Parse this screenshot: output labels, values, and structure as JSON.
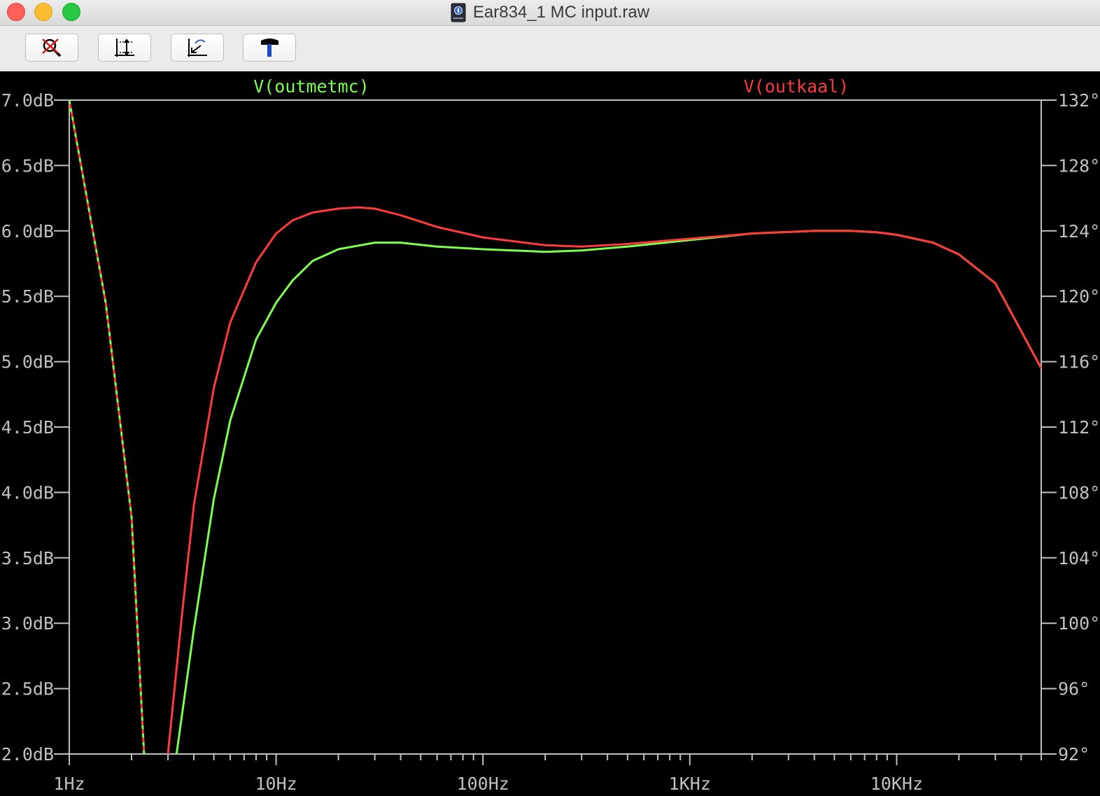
{
  "window": {
    "title": "Ear834_1 MC input.raw"
  },
  "toolbar": {
    "buttons": [
      {
        "name": "zoom-cancel",
        "icon": "zoom-cancel-icon"
      },
      {
        "name": "autorange-y",
        "icon": "autorange-y-icon"
      },
      {
        "name": "back-trace",
        "icon": "back-trace-icon"
      },
      {
        "name": "tools",
        "icon": "hammer-icon"
      }
    ]
  },
  "colors": {
    "background": "#000000",
    "axis": "#c0c0c0",
    "series_outmetmc": "#7cff4f",
    "series_outkaal": "#ff3a3a"
  },
  "chart_data": {
    "type": "line",
    "x_scale": "log",
    "x_ticks": [
      "1Hz",
      "10Hz",
      "100Hz",
      "1KHz",
      "10KHz"
    ],
    "xlim": [
      1,
      50000
    ],
    "y_left_ticks": [
      "7.0dB",
      "6.5dB",
      "6.0dB",
      "5.5dB",
      "5.0dB",
      "4.5dB",
      "4.0dB",
      "3.5dB",
      "3.0dB",
      "2.5dB",
      "2.0dB"
    ],
    "y_right_ticks": [
      "132°",
      "128°",
      "124°",
      "120°",
      "116°",
      "112°",
      "108°",
      "104°",
      "100°",
      "96°",
      "92°"
    ],
    "ylim_left": [
      2.0,
      7.0
    ],
    "ylim_right": [
      92,
      132
    ],
    "grid": false,
    "series": [
      {
        "name": "V(outmetmc)",
        "color": "#7cff4f",
        "magnitude": {
          "x": [
            3.3,
            4,
            5,
            6,
            8,
            10,
            12,
            15,
            20,
            30,
            40,
            60,
            100,
            200,
            300,
            500,
            1000,
            2000,
            4000,
            6000,
            8000,
            10000,
            15000,
            20000,
            30000,
            50000
          ],
          "y": [
            2.0,
            2.95,
            3.95,
            4.55,
            5.17,
            5.45,
            5.62,
            5.77,
            5.86,
            5.91,
            5.91,
            5.88,
            5.86,
            5.84,
            5.85,
            5.88,
            5.93,
            5.98,
            6.0,
            6.0,
            5.99,
            5.97,
            5.91,
            5.82,
            5.6,
            4.95
          ]
        },
        "phase": {
          "x": [
            1,
            1.5,
            2,
            2.3
          ],
          "y": [
            132,
            119.6,
            106.5,
            92
          ]
        }
      },
      {
        "name": "V(outkaal)",
        "color": "#ff3a3a",
        "magnitude": {
          "x": [
            3.0,
            3.5,
            4,
            5,
            6,
            8,
            10,
            12,
            15,
            20,
            25,
            30,
            40,
            60,
            100,
            200,
            300,
            500,
            1000,
            2000,
            4000,
            6000,
            8000,
            10000,
            15000,
            20000,
            30000,
            50000
          ],
          "y": [
            2.0,
            3.05,
            3.9,
            4.8,
            5.3,
            5.76,
            5.98,
            6.08,
            6.14,
            6.17,
            6.18,
            6.17,
            6.12,
            6.03,
            5.95,
            5.89,
            5.88,
            5.9,
            5.94,
            5.98,
            6.0,
            6.0,
            5.99,
            5.97,
            5.91,
            5.82,
            5.6,
            4.95
          ]
        },
        "phase": {
          "x": [
            1,
            1.5,
            2,
            2.3
          ],
          "y": [
            132,
            119.6,
            106.5,
            92
          ]
        }
      }
    ]
  }
}
